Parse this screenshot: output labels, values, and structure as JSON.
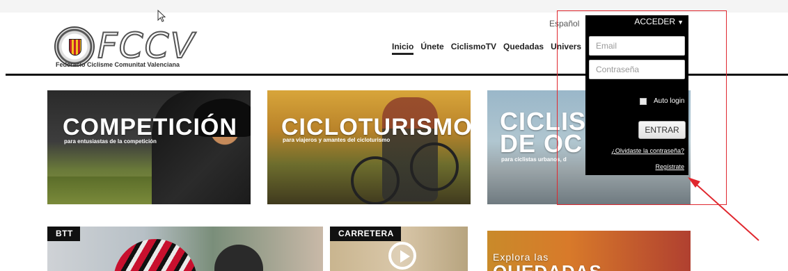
{
  "logo": {
    "wordmark": "FCCV",
    "tagline": "Federacio Ciclisme Comunitat Valenciana"
  },
  "language": "Español",
  "nav": {
    "items": [
      "Inicio",
      "Únete",
      "CiclismoTV",
      "Quedadas",
      "Univers"
    ]
  },
  "tiles": [
    {
      "title": "COMPETICIÓN",
      "subtitle": "para entusiastas de la competición"
    },
    {
      "title": "CICLOTURISMO",
      "subtitle": "para viajeros y amantes del cicloturismo"
    },
    {
      "title_line1": "CICLIS",
      "title_line2": "DE OC",
      "subtitle": "para ciclistas urbanos, d"
    }
  ],
  "bottom_tiles": [
    {
      "badge": "BTT"
    },
    {
      "badge": "CARRETERA"
    },
    {
      "line1": "Explora las",
      "line2": "QUEDADAS"
    }
  ],
  "login": {
    "toggle_label": "ACCEDER",
    "email_placeholder": "Email",
    "password_placeholder": "Contraseña",
    "auto_login_label": "Auto login",
    "submit_label": "ENTRAR",
    "forgot_link": "¿Olvidaste la contraseña?",
    "register_link": "Regístrate"
  },
  "annotation_color": "#e0272e"
}
